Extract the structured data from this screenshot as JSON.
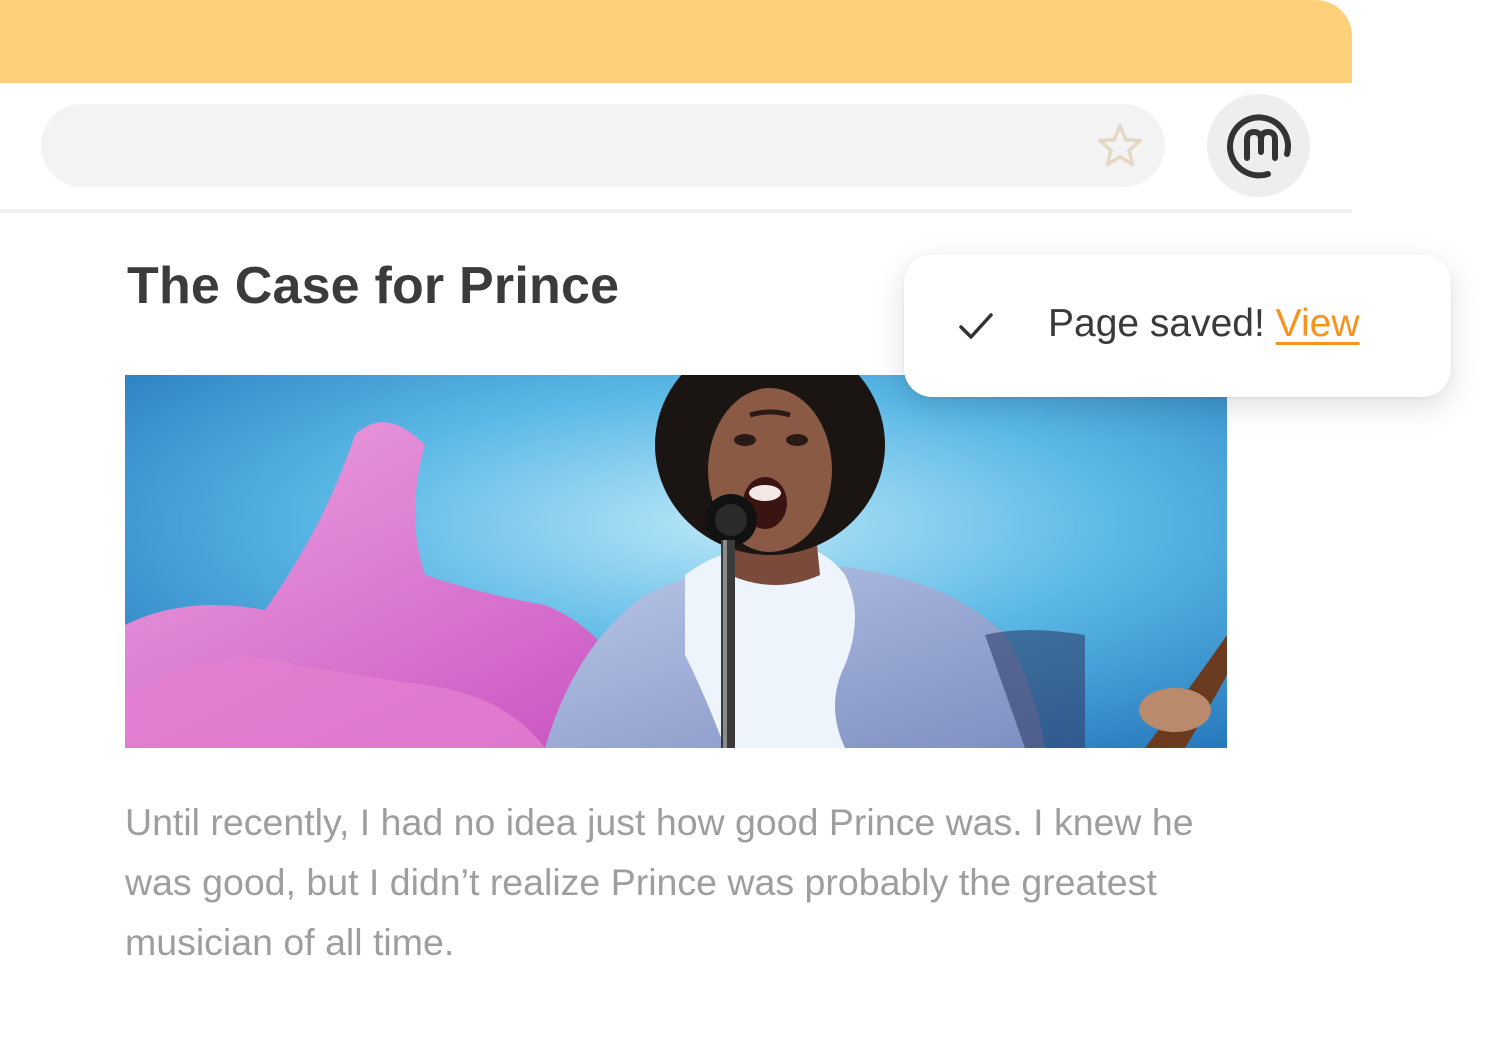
{
  "browser": {
    "topbar_color": "#ffd07a",
    "address_bar": {
      "value": "",
      "bookmark_icon": "star-outline-icon",
      "bookmark_icon_color": "#e3d8c4"
    },
    "extension_button": {
      "icon": "m-logo-icon",
      "background": "#eeeeee"
    }
  },
  "article": {
    "title": "The Case for Prince",
    "image": {
      "alt": "Prince performing at a microphone in a ruffled white shirt with a pink feather boa against a blue background",
      "subject": "Prince singing into microphone"
    },
    "body": "Until recently, I had no idea just how good Prince was. I knew he was good, but I didn’t realize Prince was probably the greatest musician of all time."
  },
  "toast": {
    "icon": "checkmark-icon",
    "message": "Page saved!",
    "link_label": "View",
    "link_color": "#f7921e"
  }
}
